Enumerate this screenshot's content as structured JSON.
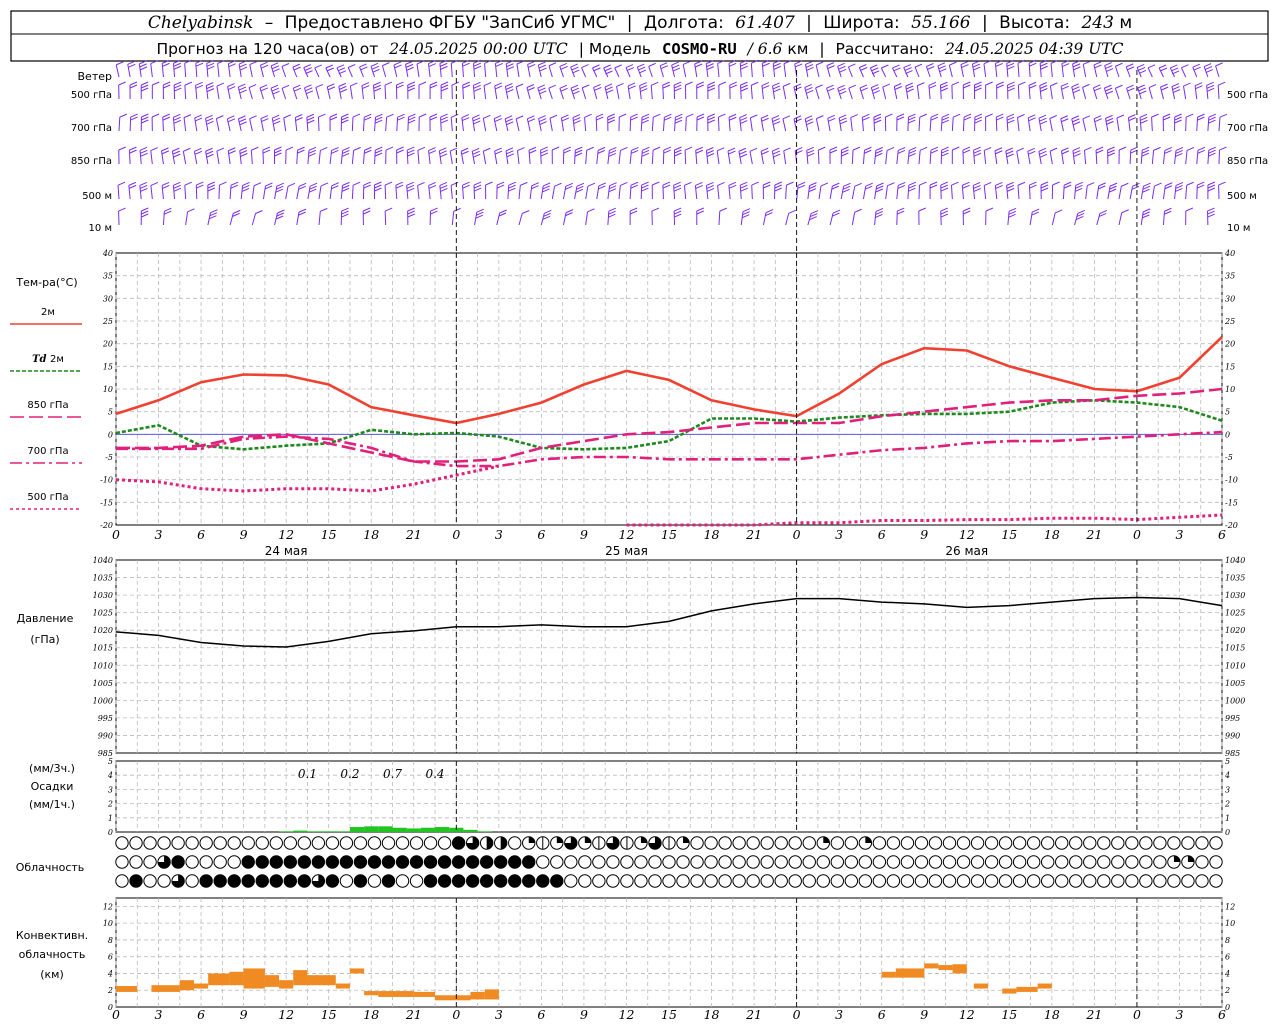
{
  "header": {
    "station": "Chelyabinsk",
    "dash": "–",
    "provider": "Предоставлено ФГБУ \"ЗапСиб УГМС\"",
    "sep": "|",
    "lon_label": "Долгота:",
    "lon_value": "61.407",
    "lat_label": "Широта:",
    "lat_value": "55.166",
    "alt_label": "Высота:",
    "alt_value": "243",
    "alt_unit": "м",
    "forecast_prefix": "Прогноз на 120 часа(ов) от",
    "forecast_start": "24.05.2025 00:00 UTC",
    "model_label": "Модель",
    "model_name": "COSMO-RU",
    "model_res": "/ 6.6",
    "model_res_unit": "км",
    "calc_label": "Рассчитано:",
    "calc_time": "24.05.2025 04:39 UTC"
  },
  "time_axis": {
    "hour_labels": [
      "0",
      "3",
      "6",
      "9",
      "12",
      "15",
      "18",
      "21",
      "0",
      "3",
      "6",
      "9",
      "12",
      "15",
      "18",
      "21",
      "0",
      "3",
      "6",
      "9",
      "12",
      "15",
      "18",
      "21",
      "0",
      "3",
      "6"
    ],
    "day_labels": [
      {
        "text": "24 мая",
        "hour_index": 4
      },
      {
        "text": "25 мая",
        "hour_index": 12
      },
      {
        "text": "26 мая",
        "hour_index": 20
      }
    ],
    "day_boundaries": [
      8,
      16,
      24
    ]
  },
  "wind_panel": {
    "labels": [
      "Ветер",
      "500 гПа",
      "700 гПа",
      "850 гПа",
      "500 м",
      "10 м"
    ],
    "right_labels": [
      "500 гПа",
      "700 гПа",
      "850 гПа",
      "500 м",
      "10 м"
    ],
    "color": "#7b2cf0"
  },
  "temp_panel": {
    "title": "Тем-ра(°С)",
    "legend": [
      {
        "label": "2м",
        "color": "#f04030",
        "style": "solid"
      },
      {
        "label_italic": "Td",
        "label": "2м",
        "color": "#1e8a1e",
        "style": "dashed"
      },
      {
        "label": "850 гПа",
        "color": "#e0207a",
        "style": "longdash"
      },
      {
        "label": "700 гПа",
        "color": "#e0207a",
        "style": "dashdot"
      },
      {
        "label": "500 гПа",
        "color": "#e0207a",
        "style": "dotted"
      }
    ],
    "yticks": [
      "40",
      "35",
      "30",
      "25",
      "20",
      "15",
      "10",
      "5",
      "0",
      "-5",
      "-10",
      "-15",
      "-20"
    ]
  },
  "pressure_panel": {
    "title": "Давление",
    "unit": "(гПа)",
    "yticks": [
      "1040",
      "1035",
      "1030",
      "1025",
      "1020",
      "1015",
      "1010",
      "1005",
      "1000",
      "995",
      "990",
      "985"
    ]
  },
  "precip_panel": {
    "unit3": "(мм/3ч.)",
    "title": "Осадки",
    "unit1": "(мм/1ч.)",
    "yticks": [
      "5",
      "4",
      "3",
      "2",
      "1",
      "0"
    ],
    "sum_labels": [
      {
        "text": "0.1",
        "hour_index": 4.5
      },
      {
        "text": "0.2",
        "hour_index": 5.5
      },
      {
        "text": "0.7",
        "hour_index": 6.5
      },
      {
        "text": "0.4",
        "hour_index": 7.5
      }
    ]
  },
  "cloud_panel": {
    "title": "Облачность"
  },
  "conv_panel": {
    "title1": "Конвективн.",
    "title2": "облачность",
    "unit": "(км)",
    "yticks": [
      "12",
      "10",
      "8",
      "6",
      "4",
      "2",
      "0"
    ]
  },
  "chart_data": [
    {
      "type": "line",
      "title": "Тем-ра(°С)",
      "ylim": [
        -20,
        40
      ],
      "x_hours": [
        0,
        3,
        6,
        9,
        12,
        15,
        18,
        21,
        24,
        27,
        30,
        33,
        36,
        39,
        42,
        45,
        48,
        51,
        54,
        57,
        60,
        63,
        66,
        69,
        72,
        75,
        78
      ],
      "series": [
        {
          "name": "2м",
          "values": [
            4.5,
            7.5,
            11.5,
            13.2,
            13,
            11,
            6,
            4.2,
            2.5,
            4.5,
            7,
            11,
            14,
            12,
            7.5,
            5.5,
            4,
            9,
            15.5,
            19,
            18.5,
            15,
            12.5,
            10,
            9.5,
            12.5,
            21.5
          ]
        },
        {
          "name": "Td 2м",
          "values": [
            0.3,
            2,
            -2.5,
            -3.3,
            -2.5,
            -2,
            1,
            0,
            0.3,
            -0.5,
            -3,
            -3.3,
            -3,
            -1.5,
            3.5,
            3.5,
            2.8,
            3.7,
            4.2,
            4.5,
            4.5,
            5,
            7,
            7.5,
            7,
            6,
            3
          ]
        },
        {
          "name": "850 гПа",
          "values": [
            -3,
            -3,
            -2.5,
            -0.5,
            0,
            -2,
            -4,
            -6,
            -6,
            -5.5,
            -3,
            -1.5,
            0,
            0.5,
            1.5,
            2.5,
            2.5,
            2.5,
            4,
            5,
            6,
            7,
            7.5,
            7.5,
            8.5,
            9,
            10
          ]
        },
        {
          "name": "700 гПа",
          "values": [
            -3.2,
            -3.2,
            -3.2,
            -1,
            -0.5,
            -1,
            -3,
            -6,
            -7,
            -7,
            -5.5,
            -5,
            -5,
            -5.5,
            -5.5,
            -5.5,
            -5.5,
            -4.5,
            -3.5,
            -3,
            -2,
            -1.5,
            -1.5,
            -1,
            -0.5,
            0,
            0.5
          ]
        },
        {
          "name": "500 гПа",
          "values": [
            -10,
            -10.5,
            -12,
            -12.5,
            -12,
            -12,
            -12.5,
            -11,
            -9,
            -7,
            null,
            null,
            -20,
            -20,
            -20,
            -20,
            -19.5,
            -19.5,
            -19,
            -19,
            -18.8,
            -18.8,
            -18.5,
            -18.5,
            -18.8,
            -18.3,
            -17.8
          ]
        }
      ]
    },
    {
      "type": "line",
      "title": "Давление",
      "ylim": [
        985,
        1040
      ],
      "x_hours": [
        0,
        3,
        6,
        9,
        12,
        15,
        18,
        21,
        24,
        27,
        30,
        33,
        36,
        39,
        42,
        45,
        48,
        51,
        54,
        57,
        60,
        63,
        66,
        69,
        72,
        75,
        78
      ],
      "series": [
        {
          "name": "Давление",
          "values": [
            1019.5,
            1018.5,
            1016.5,
            1015.5,
            1015.2,
            1016.8,
            1019,
            1019.8,
            1021,
            1021,
            1021.5,
            1021,
            1021,
            1022.5,
            1025.5,
            1027.5,
            1029,
            1029,
            1028,
            1027.5,
            1026.5,
            1027,
            1028,
            1029,
            1029.3,
            1029,
            1027
          ]
        }
      ]
    },
    {
      "type": "bar",
      "title": "Осадки",
      "ylim": [
        0,
        5
      ],
      "x_hours": [
        12,
        13,
        14,
        15,
        16,
        17,
        18,
        19,
        20,
        21,
        22,
        23,
        24,
        25,
        26
      ],
      "values": [
        0.05,
        0.1,
        0.05,
        0.05,
        0.05,
        0.35,
        0.4,
        0.4,
        0.3,
        0.25,
        0.3,
        0.35,
        0.3,
        0.15,
        0.05
      ]
    },
    {
      "type": "heatmap",
      "title": "Облачность",
      "rows": [
        "000000000000000000000000132204543453543540000000004004000000000000000000000000000000404000022000000000000000000000000222220002000",
        "000310000111111111111111111111000000000000000000000000000000000000000000000440020001111110000000013333000004000000000000000",
        "010030111111113101010011111111110000000000000000000000000000000000000000000000000000000000000000000000000000000000000000"
      ]
    },
    {
      "type": "bar",
      "title": "Конвективн. облачность",
      "ylim": [
        0,
        13
      ],
      "segments": [
        {
          "x0": 0,
          "x1": 1.5,
          "y0": 1.8,
          "y1": 2.5
        },
        {
          "x0": 2.5,
          "x1": 4.5,
          "y0": 1.8,
          "y1": 2.6
        },
        {
          "x0": 4.5,
          "x1": 5.5,
          "y0": 2,
          "y1": 3.2
        },
        {
          "x0": 5.5,
          "x1": 6.5,
          "y0": 2.2,
          "y1": 2.8
        },
        {
          "x0": 6.5,
          "x1": 8,
          "y0": 2.6,
          "y1": 4
        },
        {
          "x0": 8,
          "x1": 9,
          "y0": 2.6,
          "y1": 4.2
        },
        {
          "x0": 9,
          "x1": 10.5,
          "y0": 2.2,
          "y1": 4.6
        },
        {
          "x0": 10.5,
          "x1": 11.5,
          "y0": 2.4,
          "y1": 3.8
        },
        {
          "x0": 11.5,
          "x1": 12.5,
          "y0": 2.2,
          "y1": 3.2
        },
        {
          "x0": 12.5,
          "x1": 13.5,
          "y0": 2.6,
          "y1": 4.4
        },
        {
          "x0": 13.5,
          "x1": 15.5,
          "y0": 2.6,
          "y1": 3.8
        },
        {
          "x0": 15.5,
          "x1": 16.5,
          "y0": 2.2,
          "y1": 2.8
        },
        {
          "x0": 16.5,
          "x1": 17.5,
          "y0": 4,
          "y1": 4.6
        },
        {
          "x0": 17.5,
          "x1": 18.5,
          "y0": 1.4,
          "y1": 1.9
        },
        {
          "x0": 18.5,
          "x1": 21,
          "y0": 1.2,
          "y1": 1.9
        },
        {
          "x0": 21,
          "x1": 22.5,
          "y0": 1.2,
          "y1": 1.8
        },
        {
          "x0": 22.5,
          "x1": 24,
          "y0": 0.8,
          "y1": 1.4
        },
        {
          "x0": 24,
          "x1": 25,
          "y0": 0.8,
          "y1": 1.4
        },
        {
          "x0": 25,
          "x1": 26,
          "y0": 0.9,
          "y1": 1.8
        },
        {
          "x0": 26,
          "x1": 27,
          "y0": 0.9,
          "y1": 2.1
        },
        {
          "x0": 54,
          "x1": 55,
          "y0": 3.5,
          "y1": 4.2
        },
        {
          "x0": 55,
          "x1": 57,
          "y0": 3.5,
          "y1": 4.6
        },
        {
          "x0": 57,
          "x1": 58,
          "y0": 4.6,
          "y1": 5.2
        },
        {
          "x0": 58,
          "x1": 59,
          "y0": 4.4,
          "y1": 5
        },
        {
          "x0": 59,
          "x1": 60,
          "y0": 4,
          "y1": 5.1
        },
        {
          "x0": 60.5,
          "x1": 61.5,
          "y0": 2.2,
          "y1": 2.8
        },
        {
          "x0": 62.5,
          "x1": 63.5,
          "y0": 1.6,
          "y1": 2.2
        },
        {
          "x0": 63.5,
          "x1": 65,
          "y0": 1.8,
          "y1": 2.4
        },
        {
          "x0": 65,
          "x1": 66,
          "y0": 2.2,
          "y1": 2.8
        }
      ]
    }
  ]
}
